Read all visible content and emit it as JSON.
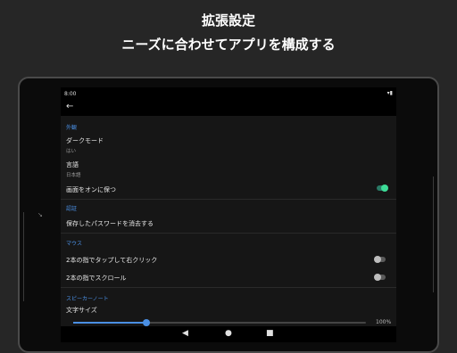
{
  "headline": {
    "line1": "拡張設定",
    "line2": "ニーズに合わせてアプリを構成する"
  },
  "status_bar": {
    "time": "8:00",
    "icons": "▾▮"
  },
  "app_bar": {
    "back_icon": "←"
  },
  "sections": {
    "appearance": "外観",
    "security": "認証",
    "mouse": "マウス",
    "speaker_notes": "スピーカーノート"
  },
  "items": {
    "dark_mode": {
      "title": "ダークモード",
      "value": "はい"
    },
    "language": {
      "title": "言語",
      "value": "日本語"
    },
    "keep_screen_on": {
      "title": "画面をオンに保つ",
      "enabled": true
    },
    "delete_passwords": {
      "title": "保存したパスワードを消去する"
    },
    "two_finger_tap": {
      "title": "2本の指でタップして右クリック",
      "enabled": false
    },
    "two_finger_scroll": {
      "title": "2本の指でスクロール",
      "enabled": false
    },
    "text_size": {
      "title": "文字サイズ",
      "value_percent": 100,
      "value_label": "100%",
      "slider_fraction": 0.25
    }
  },
  "nav": {
    "back": "◀",
    "home": "●",
    "recents": "■"
  },
  "colors": {
    "accent": "#4a8fe3",
    "toggle_on": "#3ddc97"
  }
}
